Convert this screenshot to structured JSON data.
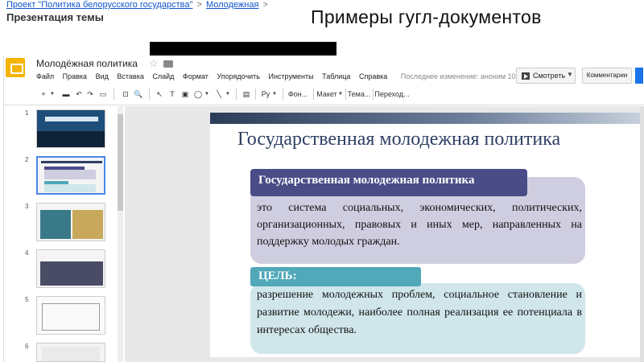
{
  "breadcrumb": {
    "items": [
      "Проект \"Политика белорусского государства\"",
      "Молодежная",
      ""
    ],
    "separator": ">"
  },
  "presentation_topic": "Презентация темы",
  "heading": "Примеры гугл-документов",
  "app": {
    "doc_title": "Молодёжная политика",
    "menu": [
      "Файл",
      "Правка",
      "Вид",
      "Вставка",
      "Слайд",
      "Формат",
      "Упорядочить",
      "Инструменты",
      "Таблица",
      "Справка"
    ],
    "last_edit": "Последнее изменение: аноним 10 м...",
    "present_label": "Смотреть",
    "comments_label": "Комментарии",
    "toolbar": {
      "font": "Ру",
      "background": "Фон...",
      "layout": "Макет",
      "theme": "Тема...",
      "transition": "Переход..."
    },
    "slide_numbers": [
      "1",
      "2",
      "3",
      "4",
      "5",
      "6"
    ],
    "selected_slide": 2
  },
  "slide": {
    "title": "Государственная молодежная политика",
    "definition_header": "Государственная молодежная политика",
    "definition_text": "это система социальных, экономических, политических, организационных, правовых и иных мер, направленных на поддержку молодых граждан.",
    "goal_header": "ЦЕЛЬ:",
    "goal_text": "разрешение молодежных проблем, социальное становление и развитие молодежи, наиболее полная реализация ее потенциала в интересах общества."
  },
  "colors": {
    "accent_blue": "#1155cc",
    "logo_yellow": "#f4b400",
    "def_header": "#4a4c88",
    "def_box": "#cfcde0",
    "goal_header": "#50a8b8",
    "goal_box": "#d0e6ea",
    "selection": "#4a86e8"
  }
}
